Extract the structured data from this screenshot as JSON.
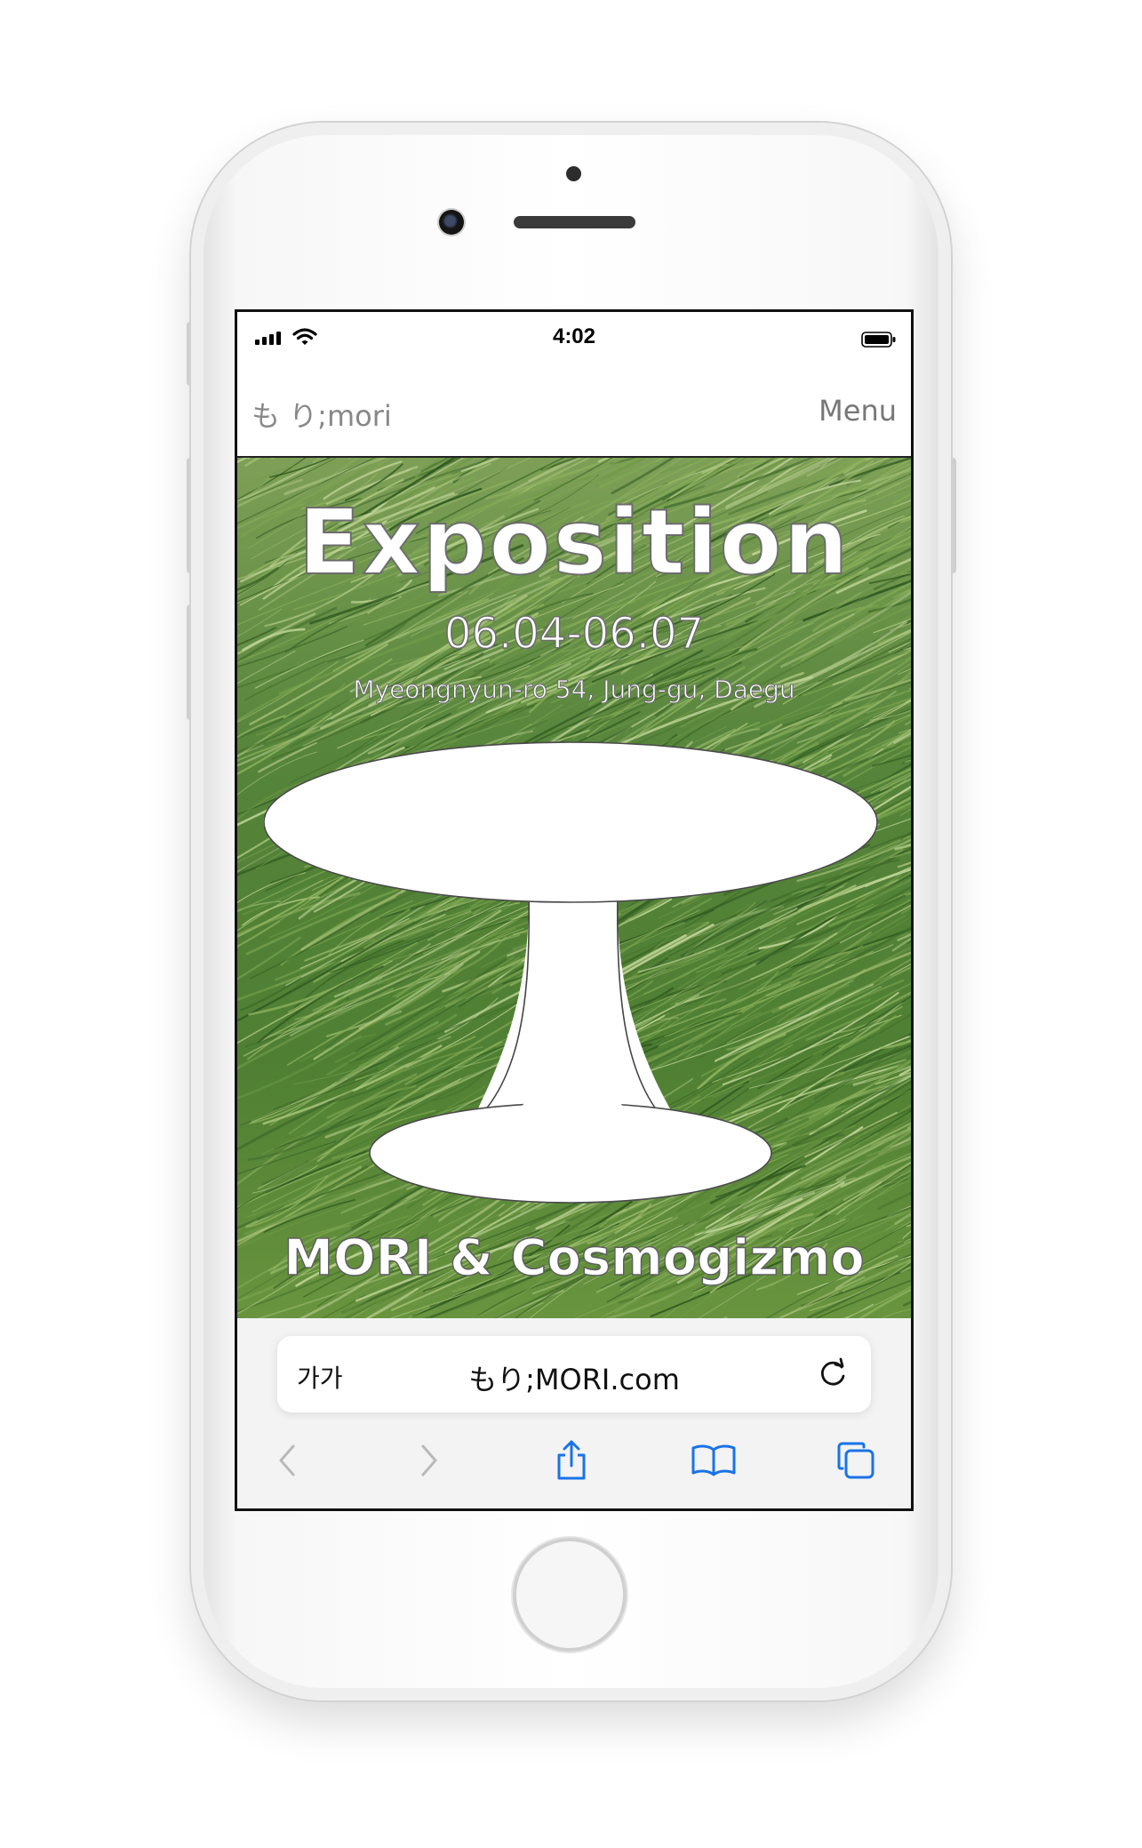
{
  "status_bar": {
    "time": "4:02"
  },
  "site_header": {
    "logo": "も り;mori",
    "menu_label": "Menu"
  },
  "hero": {
    "title": "Exposition",
    "dates": "06.04-06.07",
    "address": "Myeongnyun-ro 54, Jung-gu, Daegu",
    "artists": "MORI & Cosmogizmo"
  },
  "browser": {
    "text_size_label": "가가",
    "url": "もり;MORI.com"
  },
  "colors": {
    "accent_blue": "#1a73e8",
    "disabled_gray": "#b9b9b9",
    "grass_green": "#63893e"
  },
  "icons": [
    "back-icon",
    "forward-icon",
    "share-icon",
    "bookmarks-icon",
    "tabs-icon",
    "reload-icon",
    "wifi-icon",
    "battery-icon",
    "signal-icon"
  ]
}
